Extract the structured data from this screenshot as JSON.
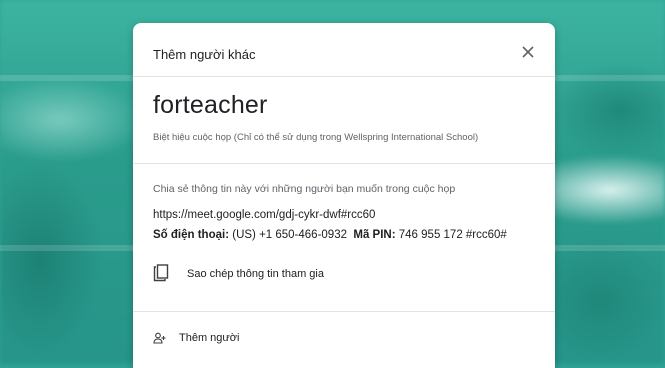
{
  "dialog": {
    "title": "Thêm người khác",
    "close_icon": "close-icon",
    "meeting_nickname": "forteacher",
    "nickname_note": "Biệt hiệu cuộc họp (Chỉ có thể sử dụng trong Wellspring International School)",
    "share_note": "Chia sẻ thông tin này với những người bạn muốn trong cuộc họp",
    "meet_url": "https://meet.google.com/gdj-cykr-dwf#rcc60",
    "phone_label": "Số điện thoại:",
    "phone_value": "(US) +1 650-466-0932",
    "pin_label": "Mã PIN:",
    "pin_value": "746 955 172 #rcc60#",
    "copy_label": "Sao chép thông tin tham gia",
    "copy_icon": "copy-icon",
    "add_label": "Thêm người",
    "add_icon": "add-person-icon"
  }
}
